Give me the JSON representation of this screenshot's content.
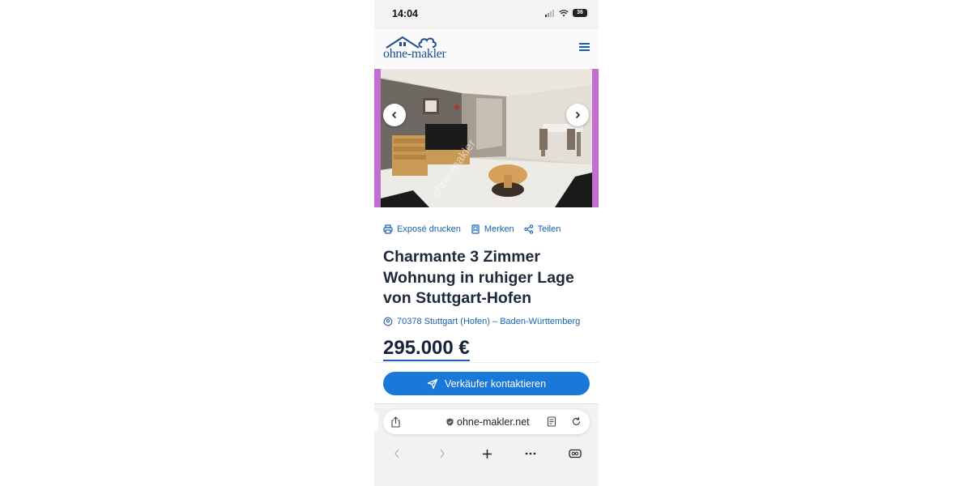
{
  "status_bar": {
    "time": "14:04",
    "battery": "36",
    "icons": [
      "signal-icon",
      "wifi-icon",
      "battery-icon"
    ]
  },
  "header": {
    "logo_text": "ohne-makler",
    "logo_icon": "house-cloud-icon",
    "menu_icon": "hamburger-menu-icon"
  },
  "gallery": {
    "prev_icon": "chevron-left-icon",
    "next_icon": "chevron-right-icon",
    "watermark": "ohne-makler"
  },
  "actions": [
    {
      "icon": "printer-icon",
      "label": "Exposé drucken"
    },
    {
      "icon": "bookmark-icon",
      "label": "Merken"
    },
    {
      "icon": "share-icon",
      "label": "Teilen"
    }
  ],
  "listing": {
    "title": "Charmante 3 Zimmer Wohnung in ruhiger Lage von Stuttgart-Hofen",
    "location": "70378 Stuttgart (Hofen) – Baden-Württemberg",
    "price": "295.000 €"
  },
  "contact_button": {
    "label": "Verkäufer kontaktieren",
    "icon": "send-icon"
  },
  "browser": {
    "url": "ohne-makler.net",
    "icons": [
      "share-icon",
      "shield-icon",
      "reader-icon",
      "reload-icon",
      "back-icon",
      "forward-icon",
      "plus-icon",
      "more-icon",
      "tabs-icon"
    ]
  },
  "colors": {
    "brand": "#1d4e8f",
    "accent": "#1a78d9",
    "link": "#1a5fb4",
    "gallery_border": "#c36fd1"
  }
}
